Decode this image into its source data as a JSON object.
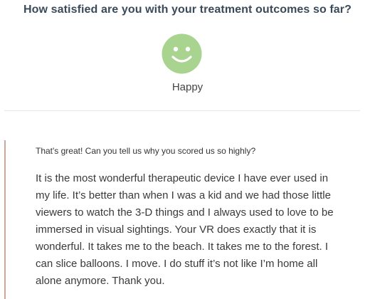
{
  "survey": {
    "question": "How satisfied are you with your treatment outcomes so far?",
    "rating": {
      "icon": "smiley-face-icon",
      "label": "Happy",
      "color": "#a8d48f"
    },
    "followup": {
      "question": "That's great! Can you tell us why you scored us so highly?",
      "answer_lines": [
        "It is the most wonderful therapeutic device I have ever used in",
        "my life. It’s better than when I was a kid and we had those little",
        "viewers to watch the 3-D things and I always used to love to be",
        "immersed in visual sightings. Your VR does exactly that it is",
        "wonderful. It takes me to the beach. It takes me to the forest. I",
        "can slice balloons. I move. I do stuff it’s not like I’m home all",
        "alone anymore. Thank you."
      ],
      "accent_color": "#c9a99a"
    }
  }
}
